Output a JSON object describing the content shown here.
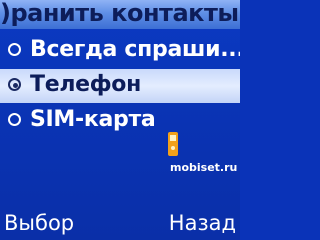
{
  "header": {
    "title": ")ранить контакты"
  },
  "menu": {
    "items": [
      {
        "label": "Всегда спраши...",
        "selected": false
      },
      {
        "label": "Телефон",
        "selected": true
      },
      {
        "label": "SIM-карта",
        "selected": false
      }
    ]
  },
  "watermark": {
    "text": "mobiset.ru",
    "icon": "phone-logo-icon"
  },
  "softkeys": {
    "left_label": "Выбор",
    "right_label": "Назад"
  },
  "colors": {
    "background": "#0a34b6",
    "title_bar": "#5f8fe6",
    "selection": "#dbe6fd",
    "accent_logo": "#f2a11a"
  }
}
